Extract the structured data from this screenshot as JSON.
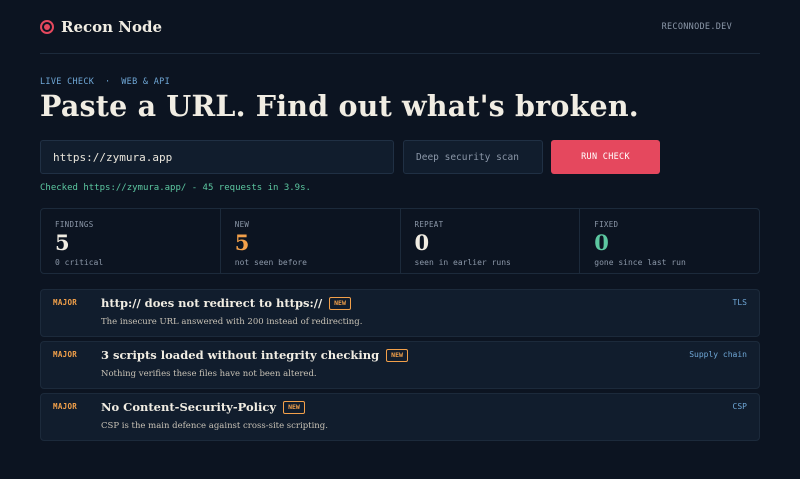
{
  "header": {
    "brand": "Recon Node",
    "site": "RECONNODE.DEV"
  },
  "hero": {
    "eyebrow": "LIVE CHECK  ·  WEB & API",
    "headline": "Paste a URL. Find out what's broken."
  },
  "form": {
    "url_value": "https://zymura.app",
    "mode_value": "Deep security scan",
    "run_label": "RUN CHECK"
  },
  "status": "Checked https://zymura.app/ - 45 requests in 3.9s.",
  "stats": [
    {
      "label": "FINDINGS",
      "value": "5",
      "sub": "0 critical",
      "color": "#f1ede3"
    },
    {
      "label": "NEW",
      "value": "5",
      "sub": "not seen before",
      "color": "#f2a04a"
    },
    {
      "label": "REPEAT",
      "value": "0",
      "sub": "seen in earlier runs",
      "color": "#f1ede3"
    },
    {
      "label": "FIXED",
      "value": "0",
      "sub": "gone since last run",
      "color": "#5cc7a0"
    }
  ],
  "findings": [
    {
      "severity": "MAJOR",
      "title": "http:// does not redirect to https://",
      "badge": "NEW",
      "description": "The insecure URL answered with 200 instead of redirecting.",
      "category": "TLS"
    },
    {
      "severity": "MAJOR",
      "title": "3 scripts loaded without integrity checking",
      "badge": "NEW",
      "description": "Nothing verifies these files have not been altered.",
      "category": "Supply chain"
    },
    {
      "severity": "MAJOR",
      "title": "No Content-Security-Policy",
      "badge": "NEW",
      "description": "CSP is the main defence against cross-site scripting.",
      "category": "CSP"
    }
  ],
  "colors": {
    "accent": "#e5485e",
    "warning": "#f2a04a",
    "success": "#5cc7a0",
    "link": "#6fa7d6"
  }
}
